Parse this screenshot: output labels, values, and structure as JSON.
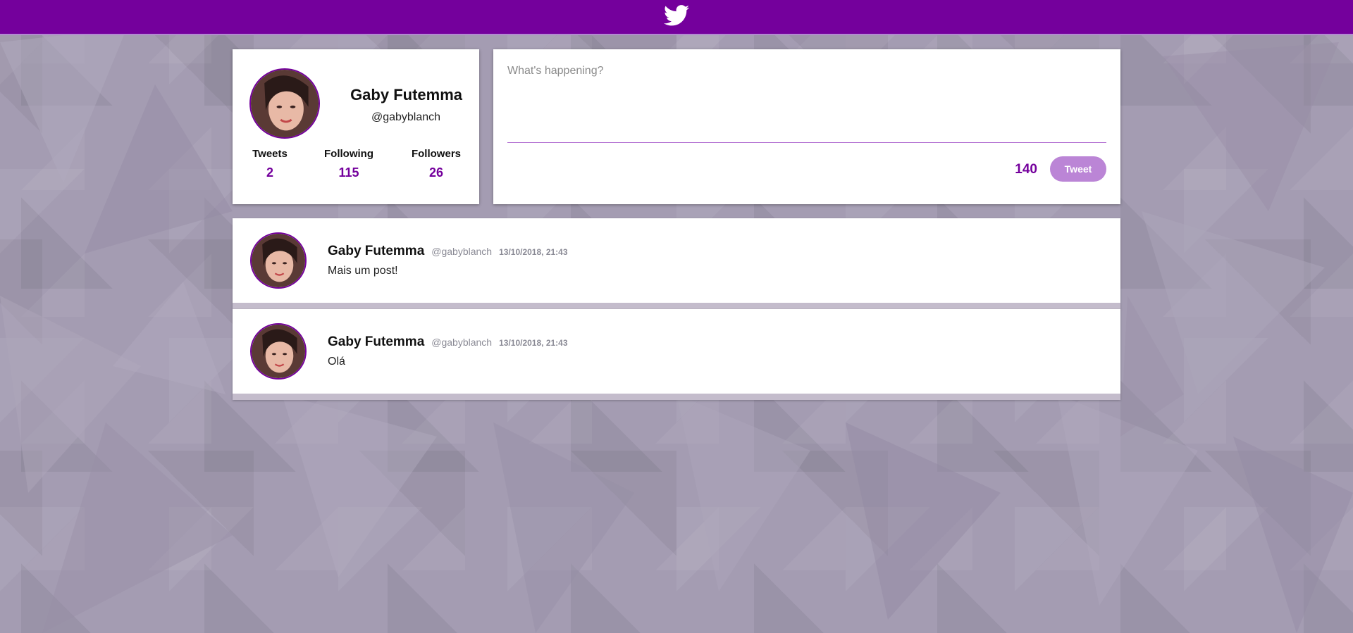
{
  "app": {
    "logo_icon": "twitter-bird-icon",
    "accent_color": "#74009c",
    "button_color": "#bb85d6"
  },
  "profile": {
    "name": "Gaby Futemma",
    "handle": "@gabyblanch",
    "avatar_icon": "user-avatar",
    "stats": {
      "tweets_label": "Tweets",
      "tweets_value": "2",
      "following_label": "Following",
      "following_value": "115",
      "followers_label": "Followers",
      "followers_value": "26"
    }
  },
  "compose": {
    "placeholder": "What's happening?",
    "char_count": "140",
    "tweet_button_label": "Tweet"
  },
  "feed": {
    "tweets": [
      {
        "author": "Gaby Futemma",
        "handle": "@gabyblanch",
        "date": "13/10/2018, 21:43",
        "text": "Mais um post!"
      },
      {
        "author": "Gaby Futemma",
        "handle": "@gabyblanch",
        "date": "13/10/2018, 21:43",
        "text": "Olá"
      }
    ]
  }
}
